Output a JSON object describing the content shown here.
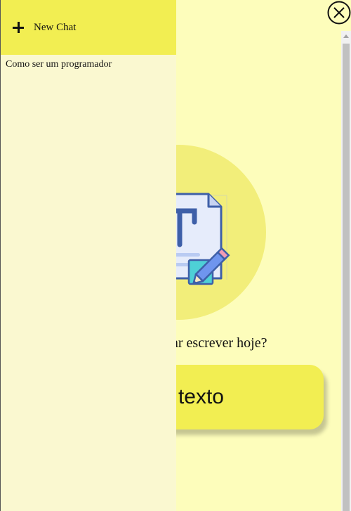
{
  "drawer": {
    "new_chat_label": "New Chat",
    "chats": [
      {
        "title": "Como ser um programador"
      }
    ]
  },
  "main": {
    "prompt_visible": "ar escrever hoje?",
    "cta_visible": "texto"
  },
  "icons": {
    "close": "close-icon",
    "plus": "plus-icon",
    "illustration": "document-pencil-illustration"
  },
  "colors": {
    "background": "#fdfdbb",
    "accent": "#f2ee52",
    "drawer": "#faf8d0",
    "circle": "#f2ee7a"
  }
}
